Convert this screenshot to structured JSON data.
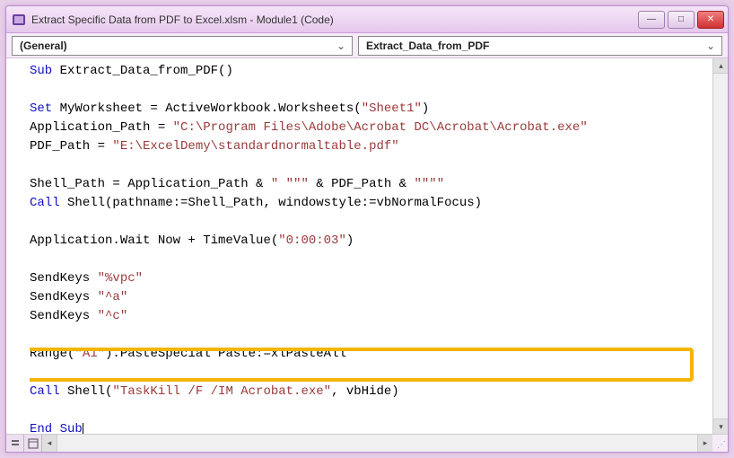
{
  "window": {
    "title": "Extract Specific Data from PDF to Excel.xlsm - Module1 (Code)"
  },
  "dropdowns": {
    "object": "(General)",
    "procedure": "Extract_Data_from_PDF"
  },
  "code": {
    "sub_kw": "Sub",
    "sub_name": " Extract_Data_from_PDF()",
    "l_set_kw": "Set",
    "l_set_rest": " MyWorksheet = ActiveWorkbook.Worksheets(",
    "l_set_str": "\"Sheet1\"",
    "l_set_close": ")",
    "l_apppath_lhs": "Application_Path = ",
    "l_apppath_str": "\"C:\\Program Files\\Adobe\\Acrobat DC\\Acrobat\\Acrobat.exe\"",
    "l_pdfpath_lhs": "PDF_Path = ",
    "l_pdfpath_str": "\"E:\\ExcelDemy\\standardnormaltable.pdf\"",
    "l_shellpath_1": "Shell_Path = Application_Path & ",
    "l_shellpath_s1": "\" \"\"\"",
    "l_shellpath_2": " & PDF_Path & ",
    "l_shellpath_s2": "\"\"\"\"",
    "l_call1_kw": "Call",
    "l_call1_rest": " Shell(pathname:=Shell_Path, windowstyle:=vbNormalFocus)",
    "l_wait_1": "Application.Wait Now + TimeValue(",
    "l_wait_str": "\"0:00:03\"",
    "l_wait_2": ")",
    "l_sk1_a": "SendKeys ",
    "l_sk1_s": "\"%vpc\"",
    "l_sk2_a": "SendKeys ",
    "l_sk2_s": "\"^a\"",
    "l_sk3_a": "SendKeys ",
    "l_sk3_s": "\"^c\"",
    "l_range_1": "Range(",
    "l_range_s": "\"A1\"",
    "l_range_2": ").PasteSpecial Paste:=xlPasteAll",
    "l_call2_kw": "Call",
    "l_call2_1": " Shell(",
    "l_call2_s": "\"TaskKill /F /IM Acrobat.exe\"",
    "l_call2_2": ", vbHide)",
    "end_sub": "End Sub"
  },
  "icons": {
    "minimize": "—",
    "maximize": "□",
    "close": "✕",
    "dropdown_arrow": "⌄",
    "scroll_up": "▴",
    "scroll_down": "▾",
    "scroll_left": "◂",
    "scroll_right": "▸",
    "grip": "⋰"
  }
}
